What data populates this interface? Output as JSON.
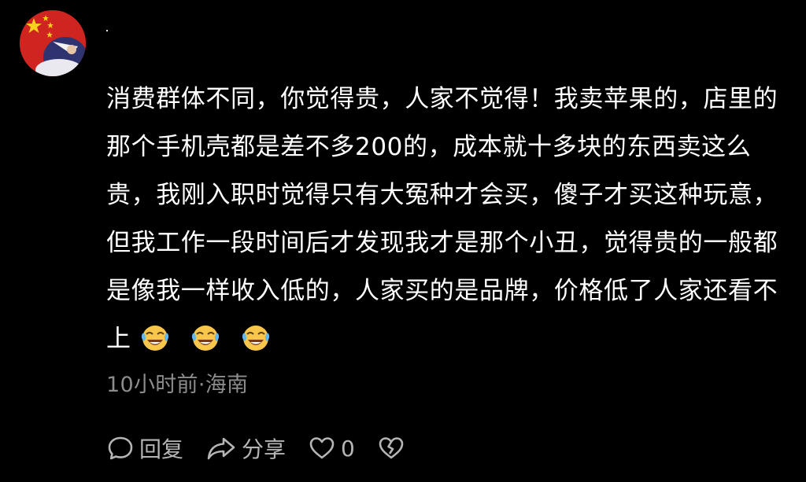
{
  "comment": {
    "author_avatar": "avatar-flag-icon",
    "text": "消费群体不同，你觉得贵，人家不觉得！我卖苹果的，店里的那个手机壳都是差不多200的，成本就十多块的东西卖这么贵，我刚入职时觉得只有大冤种才会买，傻子才买这种玩意，但我工作一段时间后才发现我才是那个小丑，觉得贵的一般都是像我一样收入低的，人家买的是品牌，价格低了人家还看不上",
    "emojis": [
      "laughing-crying-emoji-icon",
      "laughing-crying-emoji-icon",
      "laughing-crying-emoji-icon"
    ],
    "time_location": "10小时前·海南"
  },
  "actions": {
    "reply_label": "回复",
    "share_label": "分享",
    "like_count": "0"
  },
  "colors": {
    "background": "#000000",
    "text": "#ffffff",
    "meta": "#8c8c8c",
    "action": "#b5b5b5"
  }
}
